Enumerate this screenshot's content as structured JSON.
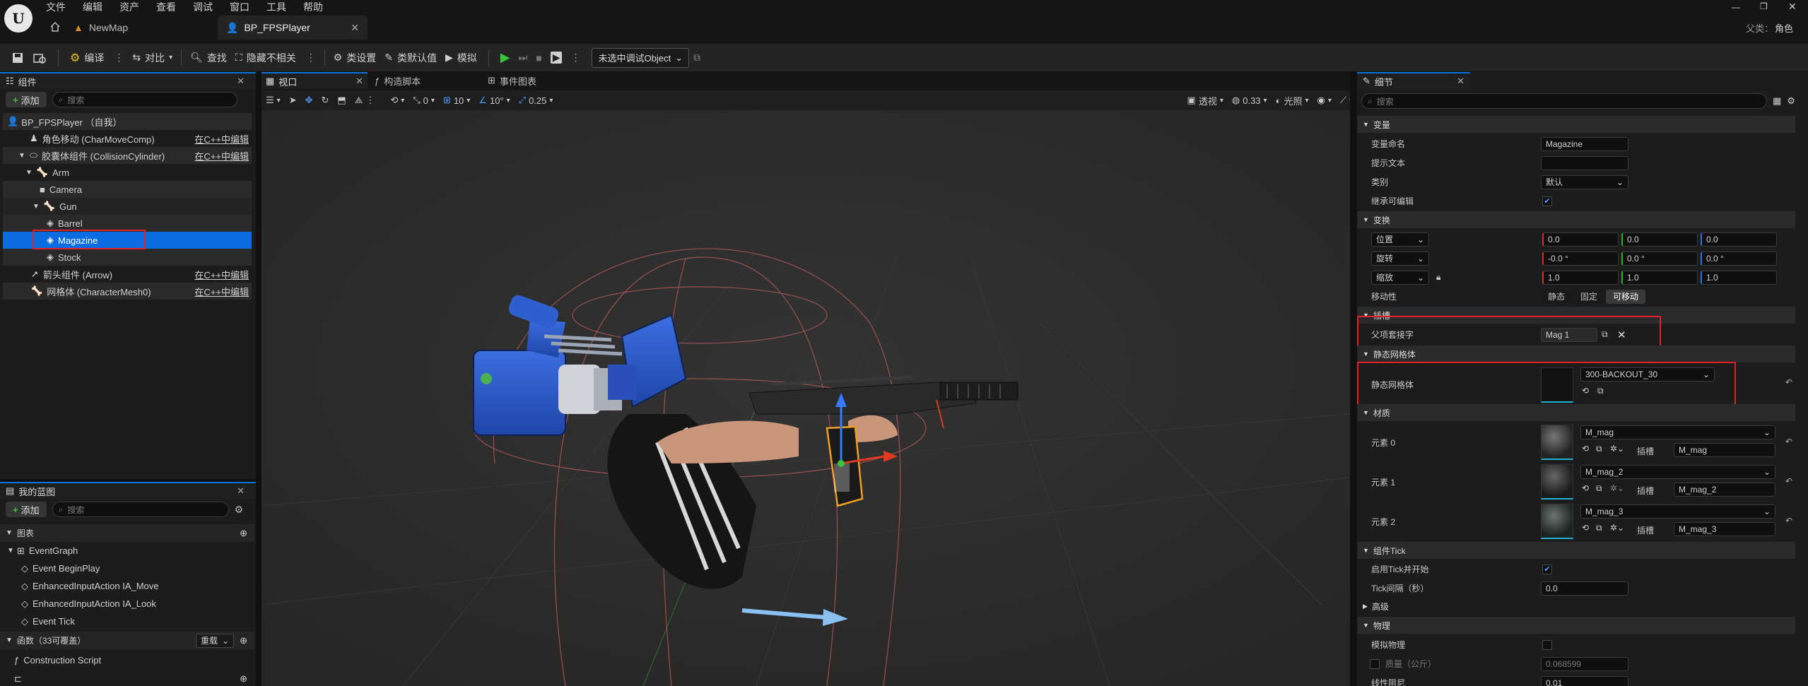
{
  "app": {
    "logo": "unreal-engine-logo"
  },
  "menu": [
    "文件",
    "编辑",
    "资产",
    "查看",
    "调试",
    "窗口",
    "工具",
    "帮助"
  ],
  "tabs": [
    {
      "label": "NewMap"
    },
    {
      "label": "BP_FPSPlayer"
    }
  ],
  "window_info": {
    "parent_label": "父类：",
    "parent_value": "角色"
  },
  "toolbar": {
    "compile": "编译",
    "diff": "对比",
    "find": "查找",
    "hide_unrelated": "隐藏不相关",
    "class_settings": "类设置",
    "class_defaults": "类默认值",
    "simulate": "模拟",
    "debug_object": "未选中调试Object"
  },
  "components": {
    "tab": "组件",
    "add": "添加",
    "search_placeholder": "搜索",
    "rows": [
      {
        "label": "BP_FPSPlayer （自我）",
        "edit": ""
      },
      {
        "label": "角色移动 (CharMoveComp)",
        "edit": "在C++中编辑"
      },
      {
        "label": "胶囊体组件 (CollisionCylinder)",
        "edit": "在C++中编辑"
      },
      {
        "label": "Arm",
        "edit": ""
      },
      {
        "label": "Camera",
        "edit": ""
      },
      {
        "label": "Gun",
        "edit": ""
      },
      {
        "label": "Barrel",
        "edit": ""
      },
      {
        "label": "Magazine",
        "edit": ""
      },
      {
        "label": "Stock",
        "edit": ""
      },
      {
        "label": "箭头组件 (Arrow)",
        "edit": "在C++中编辑"
      },
      {
        "label": "网格体 (CharacterMesh0)",
        "edit": "在C++中编辑"
      }
    ]
  },
  "blueprint": {
    "tab": "我的蓝图",
    "add": "添加",
    "search_placeholder": "搜索",
    "graphs_section": "图表",
    "event_graph": "EventGraph",
    "events": [
      "Event BeginPlay",
      "EnhancedInputAction IA_Move",
      "EnhancedInputAction IA_Look",
      "Event Tick"
    ],
    "functions_section": "函数（33可覆盖）",
    "override": "重载",
    "construction_script": "Construction Script"
  },
  "viewport": {
    "tabs": [
      "视口",
      "构造脚本",
      "事件图表"
    ],
    "view_mode": "透视",
    "lit": "光照",
    "snap_translate": "10",
    "snap_rotate": "10°",
    "snap_scale": "0.25",
    "camera_speed": "0.33",
    "rotate_count": "0"
  },
  "details": {
    "tab": "细节",
    "search_placeholder": "搜索",
    "variable_section": "变量",
    "var_name_label": "变量命名",
    "var_name": "Magazine",
    "tooltip_label": "提示文本",
    "category_label": "类别",
    "category": "默认",
    "instance_editable_label": "继承可编辑",
    "transform_section": "变换",
    "location": "位置",
    "rotation": "旋转",
    "scale": "缩放",
    "loc": [
      "0.0",
      "0.0",
      "0.0"
    ],
    "rot": [
      "-0.0 °",
      "0.0 °",
      "0.0 °"
    ],
    "scl": [
      "1.0",
      "1.0",
      "1.0"
    ],
    "mobility_label": "移动性",
    "mobility": [
      "静态",
      "固定",
      "可移动"
    ],
    "socket_section": "插槽",
    "parent_socket_label": "父项套接字",
    "parent_socket": "Mag 1",
    "static_mesh_section": "静态网格体",
    "static_mesh_label": "静态网格体",
    "static_mesh": "300-BACKOUT_30",
    "materials_section": "材质",
    "slot_label": "插槽",
    "materials": [
      {
        "label": "元素 0",
        "mat": "M_mag",
        "slot": "M_mag"
      },
      {
        "label": "元素 1",
        "mat": "M_mag_2",
        "slot": "M_mag_2"
      },
      {
        "label": "元素 2",
        "mat": "M_mag_3",
        "slot": "M_mag_3"
      }
    ],
    "tick_section": "组件Tick",
    "tick_start_label": "启用Tick并开始",
    "tick_interval_label": "Tick间隔（秒）",
    "tick_interval": "0.0",
    "advanced_section": "高级",
    "physics_section": "物理",
    "simulate_physics_label": "模拟物理",
    "mass_label": "质量（公斤）",
    "mass": "0.068599",
    "linear_damping_label": "线性阻尼",
    "linear_damping": "0.01"
  },
  "colors": {
    "accent": "#0a74e0",
    "selection": "#0a6ce0",
    "highlight_box": "#e0202a",
    "gun_blue": "#2f5fcf"
  }
}
